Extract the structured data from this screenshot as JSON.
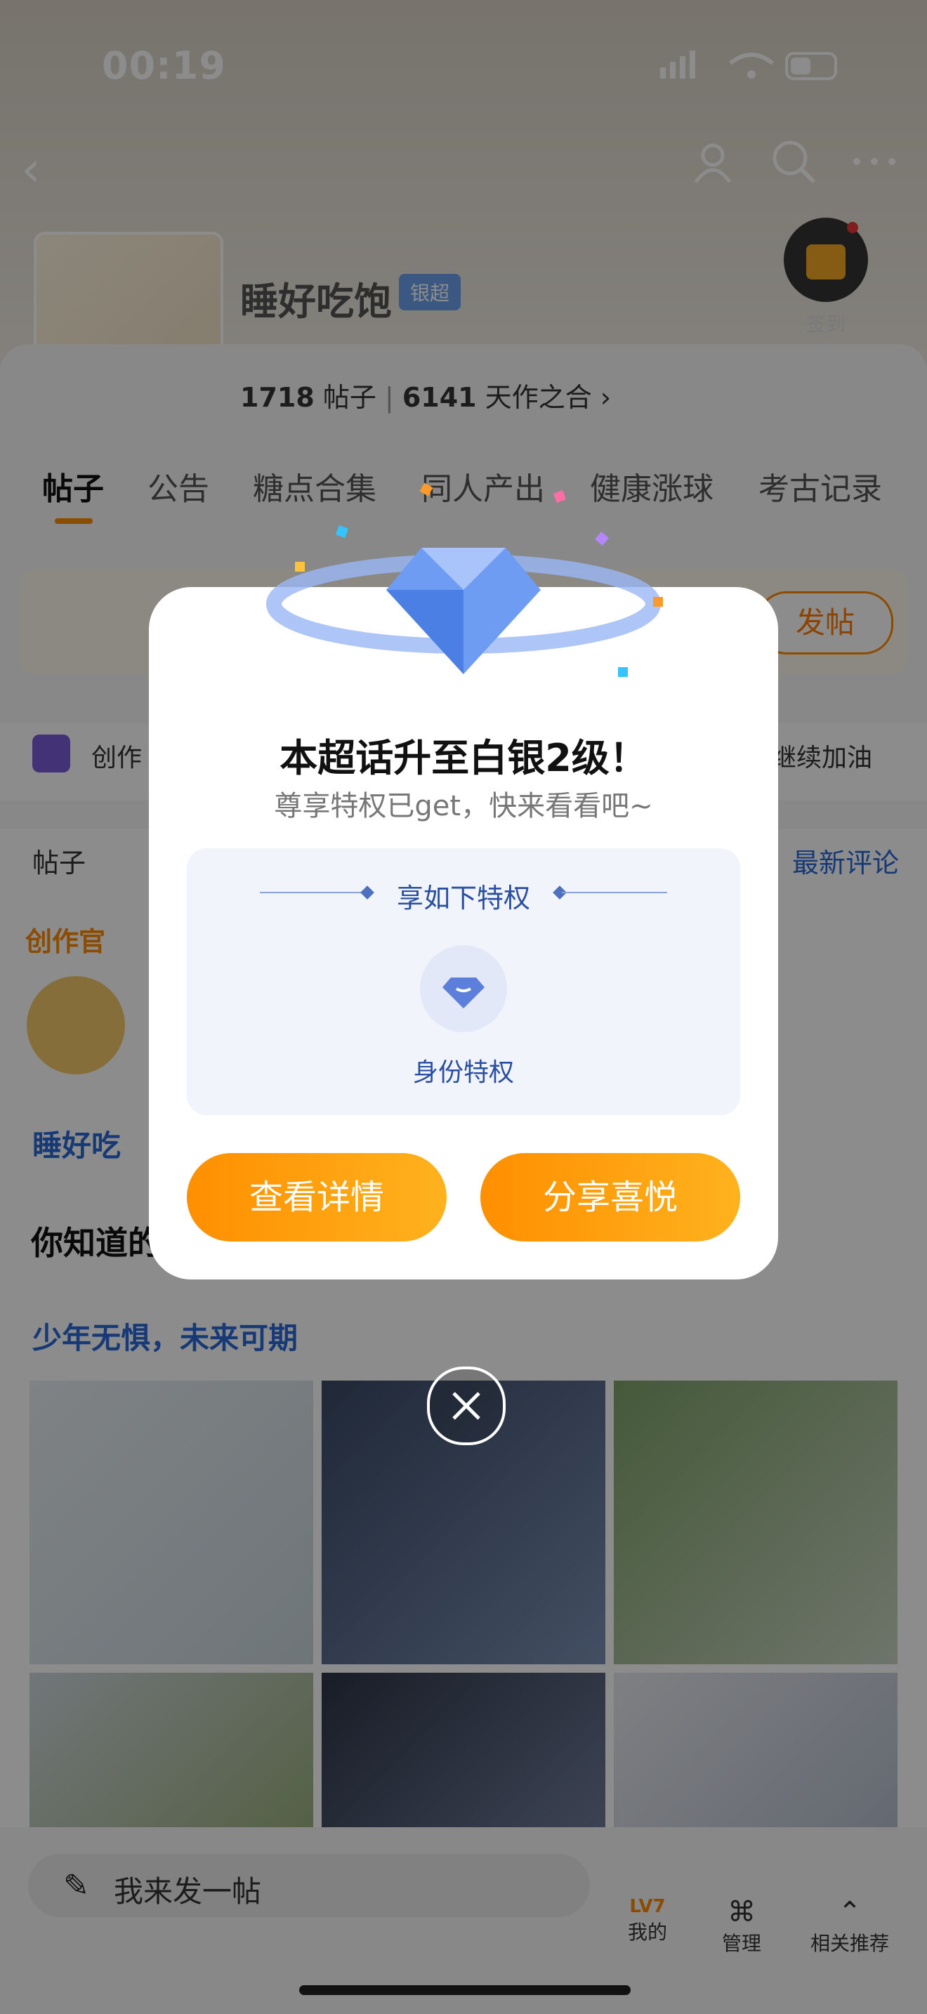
{
  "status_bar": {
    "time": "00:19"
  },
  "header": {
    "community_name": "睡好吃饱",
    "badge": "银超",
    "signin_label": "签到",
    "posts_count": "1718",
    "posts_label": "帖子",
    "fans_count": "6141",
    "fans_label": "天作之合"
  },
  "tabs": [
    "帖子",
    "公告",
    "糖点合集",
    "同人产出",
    "健康涨球",
    "考古记录"
  ],
  "hi_card": {
    "post_button": "发帖"
  },
  "creator_row": {
    "label": "创作",
    "action": "继续加油"
  },
  "section": {
    "label": "帖子",
    "sort": "最新评论"
  },
  "feed": {
    "officer_label": "创作官",
    "author": "睡好吃",
    "text": "你知道的",
    "topic": "少年无惧，未来可期"
  },
  "bottom_bar": {
    "composer_placeholder": "我来发一帖",
    "nav": [
      "我的",
      "管理",
      "相关推荐"
    ],
    "level_badge": "LV7"
  },
  "modal": {
    "title": "本超话升至白银2级！",
    "subtitle": "尊享特权已get，快来看看吧~",
    "privilege_heading": "享如下特权",
    "privilege_label": "身份特权",
    "view_button": "查看详情",
    "share_button": "分享喜悦"
  },
  "colors": {
    "accent": "#ff8a00",
    "link": "#2b68d8",
    "modal_bg": "#ffffff"
  }
}
